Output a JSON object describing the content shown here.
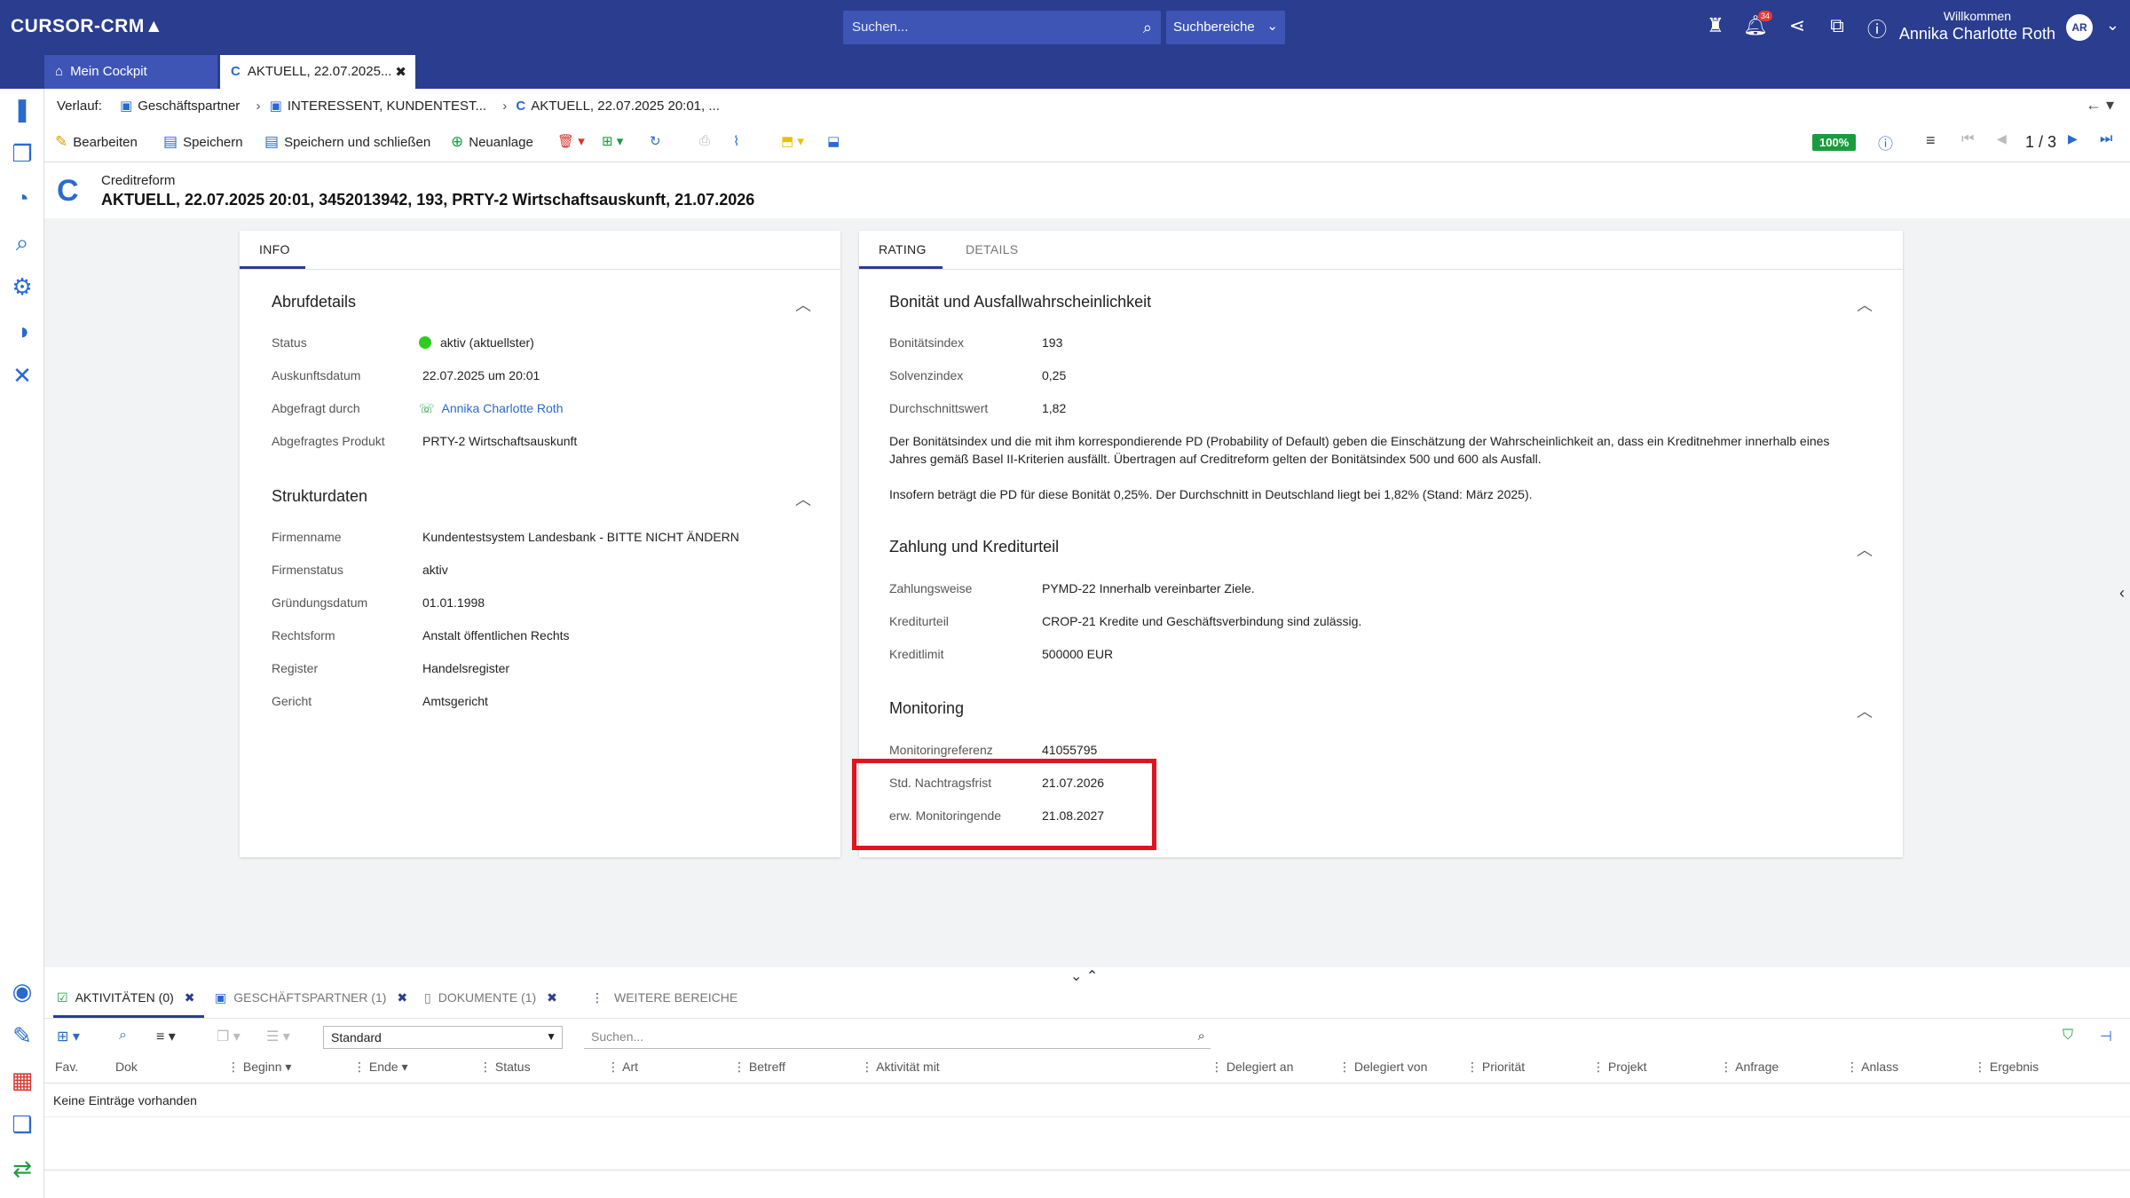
{
  "app": {
    "logo": "CURSOR-CRM",
    "search_placeholder": "Suchen...",
    "suchbereiche": "Suchbereiche",
    "notif_count": "34",
    "welcome_label": "Willkommen",
    "user_name": "Annika Charlotte Roth",
    "user_initials": "AR"
  },
  "tabs": [
    {
      "label": "Mein Cockpit"
    },
    {
      "label": "AKTUELL, 22.07.2025..."
    }
  ],
  "breadcrumb": {
    "prefix": "Verlauf:",
    "items": [
      "Geschäftspartner",
      "INTERESSENT, KUNDENTEST...",
      "AKTUELL, 22.07.2025 20:01, ..."
    ]
  },
  "toolbar": {
    "edit": "Bearbeiten",
    "save": "Speichern",
    "save_close": "Speichern und schließen",
    "new": "Neuanlage",
    "zoom": "100%",
    "pager": "1 / 3"
  },
  "record": {
    "subtitle": "Creditreform",
    "title": "AKTUELL, 22.07.2025 20:01, 3452013942, 193, PRTY-2 Wirtschaftsauskunft, 21.07.2026"
  },
  "left_panel": {
    "tab": "INFO",
    "abruf": {
      "title": "Abrufdetails",
      "status_label": "Status",
      "status_value": "aktiv (aktuellster)",
      "date_label": "Auskunftsdatum",
      "date_value": "22.07.2025 um 20:01",
      "by_label": "Abgefragt durch",
      "by_value": "Annika Charlotte Roth",
      "product_label": "Abgefragtes Produkt",
      "product_value": "PRTY-2 Wirtschaftsauskunft"
    },
    "struktur": {
      "title": "Strukturdaten",
      "rows": [
        {
          "label": "Firmenname",
          "value": "Kundentestsystem Landesbank - BITTE NICHT ÄNDERN"
        },
        {
          "label": "Firmenstatus",
          "value": "aktiv"
        },
        {
          "label": "Gründungsdatum",
          "value": "01.01.1998"
        },
        {
          "label": "Rechtsform",
          "value": "Anstalt öffentlichen Rechts"
        },
        {
          "label": "Register",
          "value": "Handelsregister"
        },
        {
          "label": "Gericht",
          "value": "Amtsgericht"
        }
      ]
    }
  },
  "right_panel": {
    "tab_rating": "RATING",
    "tab_details": "DETAILS",
    "bonitaet": {
      "title": "Bonität und Ausfallwahrscheinlichkeit",
      "rows": [
        {
          "label": "Bonitätsindex",
          "value": "193"
        },
        {
          "label": "Solvenzindex",
          "value": "0,25"
        },
        {
          "label": "Durchschnittswert",
          "value": "1,82"
        }
      ],
      "para1": "Der Bonitätsindex und die mit ihm korrespondierende PD (Probability of Default) geben die Einschätzung der Wahrscheinlichkeit an, dass ein Kreditnehmer innerhalb eines Jahres gemäß Basel II-Kriterien ausfällt. Übertragen auf Creditreform gelten der Bonitätsindex 500 und 600 als Ausfall.",
      "para2": "Insofern beträgt die PD für diese Bonität 0,25%. Der Durchschnitt in Deutschland liegt bei 1,82% (Stand: März 2025)."
    },
    "zahlung": {
      "title": "Zahlung und Krediturteil",
      "rows": [
        {
          "label": "Zahlungsweise",
          "value": "PYMD-22 Innerhalb vereinbarter Ziele."
        },
        {
          "label": "Krediturteil",
          "value": "CROP-21 Kredite und Geschäftsverbindung sind zulässig."
        },
        {
          "label": "Kreditlimit",
          "value": "500000 EUR"
        }
      ]
    },
    "monitoring": {
      "title": "Monitoring",
      "rows": [
        {
          "label": "Monitoringreferenz",
          "value": "41055795"
        },
        {
          "label": "Std. Nachtragsfrist",
          "value": "21.07.2026"
        },
        {
          "label": "erw. Monitoringende",
          "value": "21.08.2027"
        }
      ]
    }
  },
  "bottom": {
    "tabs": [
      {
        "label": "AKTIVITÄTEN (0)"
      },
      {
        "label": "GESCHÄFTSPARTNER (1)"
      },
      {
        "label": "DOKUMENTE (1)"
      },
      {
        "label": "WEITERE BEREICHE"
      }
    ],
    "select_value": "Standard",
    "search_placeholder": "Suchen...",
    "columns": [
      "Fav.",
      "Dok",
      "Beginn",
      "Ende",
      "Status",
      "Art",
      "Betreff",
      "Aktivität mit",
      "Delegiert an",
      "Delegiert von",
      "Priorität",
      "Projekt",
      "Anfrage",
      "Anlass",
      "Ergebnis"
    ],
    "empty": "Keine Einträge vorhanden"
  }
}
